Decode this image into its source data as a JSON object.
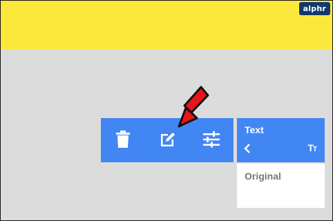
{
  "watermark": {
    "text": "alphr"
  },
  "toolbar": {
    "icons": [
      "trash-icon",
      "edit-icon",
      "sliders-icon"
    ]
  },
  "text_panel": {
    "title": "Text",
    "back_icon": "chevron-left-icon",
    "font_size_icon": {
      "large": "T",
      "small": "T"
    },
    "options": [
      {
        "label": "Original"
      }
    ]
  },
  "annotation": {
    "icon": "red-arrow",
    "color": "#e8141a"
  },
  "colors": {
    "accent": "#4286f4",
    "banner": "#fbe83d",
    "background": "#dcdcdc"
  }
}
